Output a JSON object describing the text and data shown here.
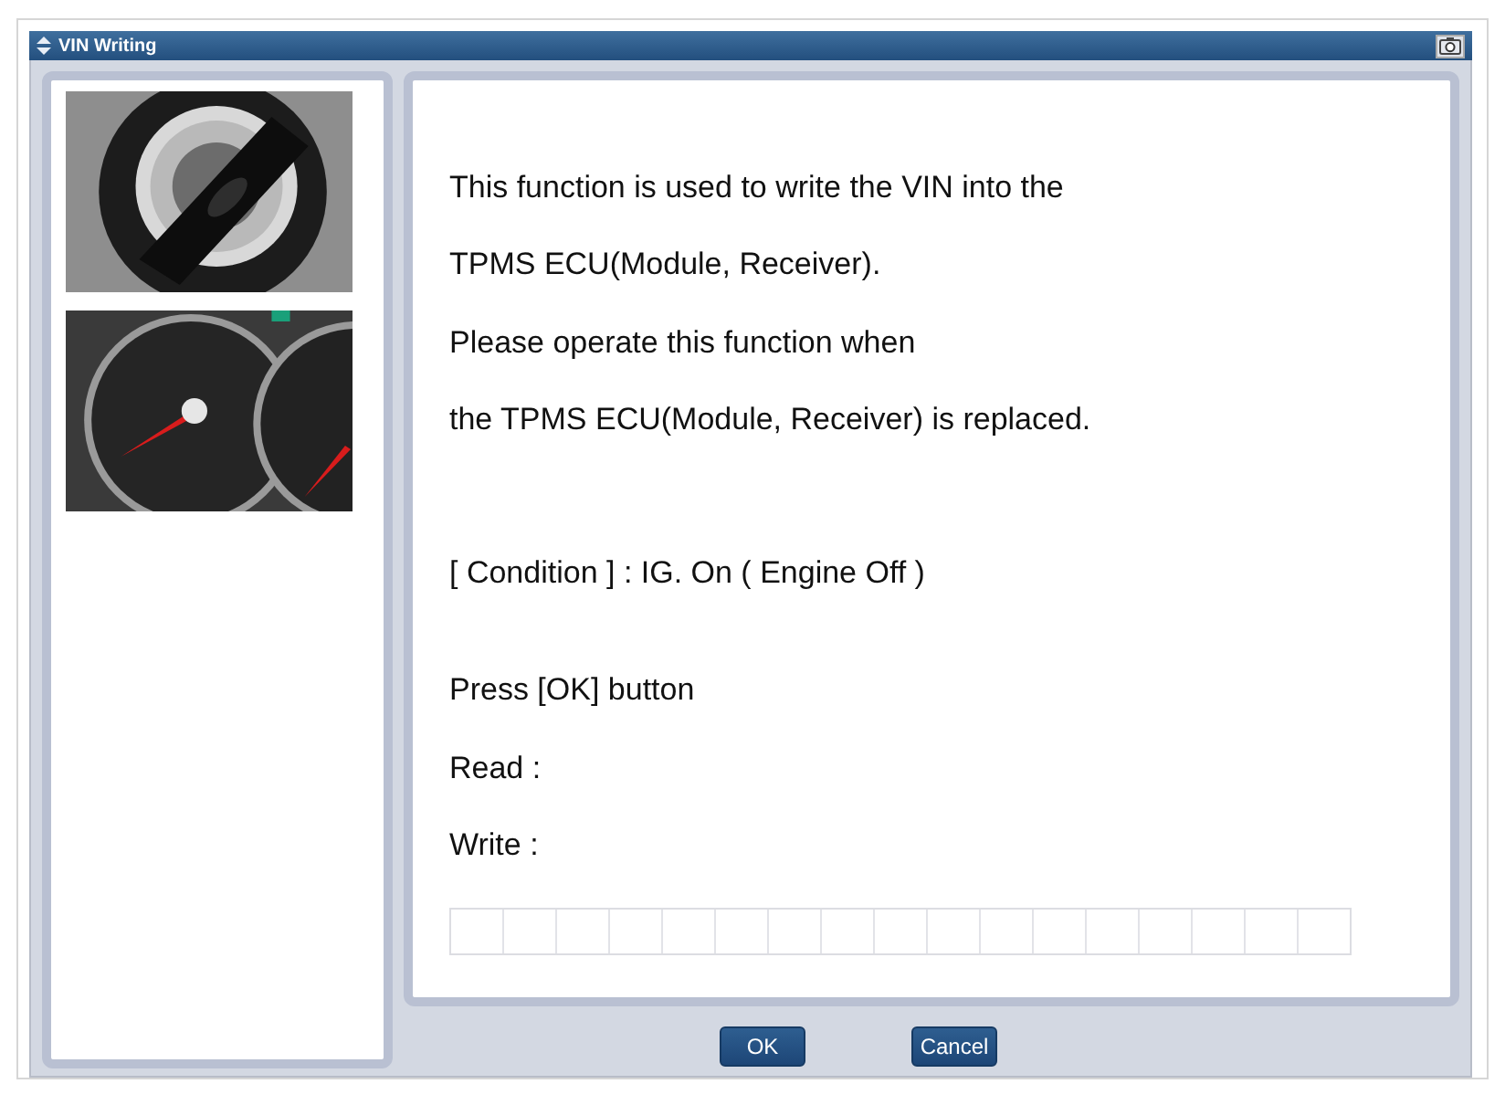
{
  "window": {
    "title": "VIN Writing"
  },
  "pictures": [
    {
      "kind": "picture"
    },
    {
      "kind": "picture"
    }
  ],
  "message_groups": [
    [
      "This function is used to write the VIN into the",
      "TPMS ECU(Module, Receiver).",
      "Please operate this function when",
      "the TPMS ECU(Module, Receiver) is replaced."
    ],
    [
      "[ Condition ] : IG. On ( Engine Off )"
    ],
    [
      "Press [OK] button",
      "Read :",
      "Write :"
    ]
  ],
  "buttons": [
    "OK",
    "Cancel"
  ]
}
